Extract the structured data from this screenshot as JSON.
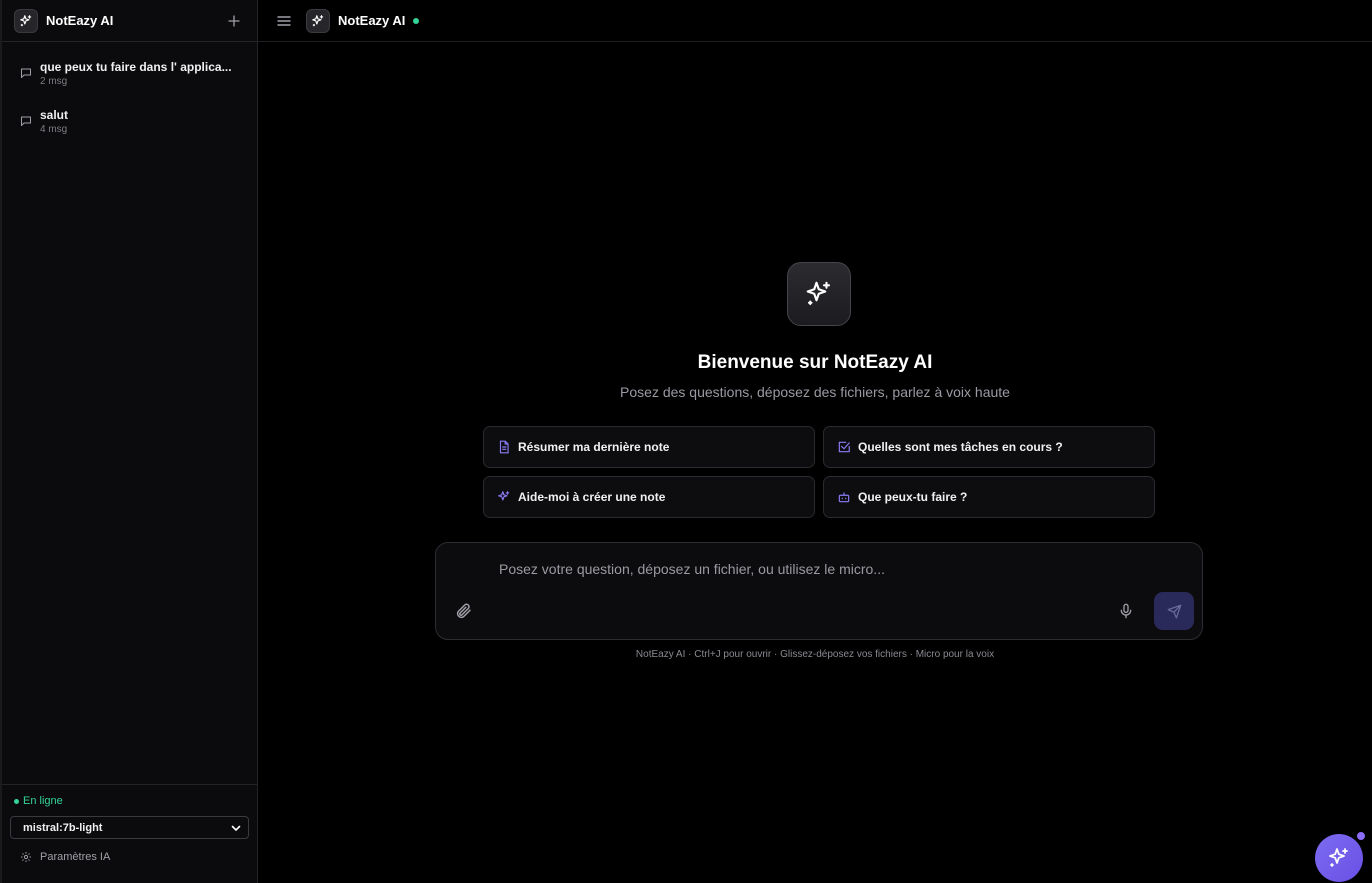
{
  "sidebar": {
    "title": "NotEazy AI",
    "conversations": [
      {
        "title": "que peux tu faire dans l' applica...",
        "meta": "2 msg"
      },
      {
        "title": "salut",
        "meta": "4 msg"
      }
    ],
    "status": "En ligne",
    "model": "mistral:7b-light",
    "settings_label": "Paramètres IA"
  },
  "topbar": {
    "title": "NotEazy AI"
  },
  "main": {
    "welcome": "Bienvenue sur NotEazy AI",
    "subtitle": "Posez des questions, déposez des fichiers, parlez à voix haute",
    "suggestions": [
      {
        "label": "Résumer ma dernière note",
        "icon": "document-icon"
      },
      {
        "label": "Quelles sont mes tâches en cours ?",
        "icon": "checkbox-icon"
      },
      {
        "label": "Aide-moi à créer une note",
        "icon": "sparkles-icon"
      },
      {
        "label": "Que peux-tu faire ?",
        "icon": "robot-icon"
      }
    ],
    "composer_placeholder": "Posez votre question, déposez un fichier, ou utilisez le micro...",
    "hint": "NotEazy AI · Ctrl+J pour ouvrir · Glissez-déposez vos fichiers · Micro pour la voix"
  },
  "colors": {
    "accent": "#7c6cf0",
    "status": "#34d399",
    "background": "#000000"
  }
}
